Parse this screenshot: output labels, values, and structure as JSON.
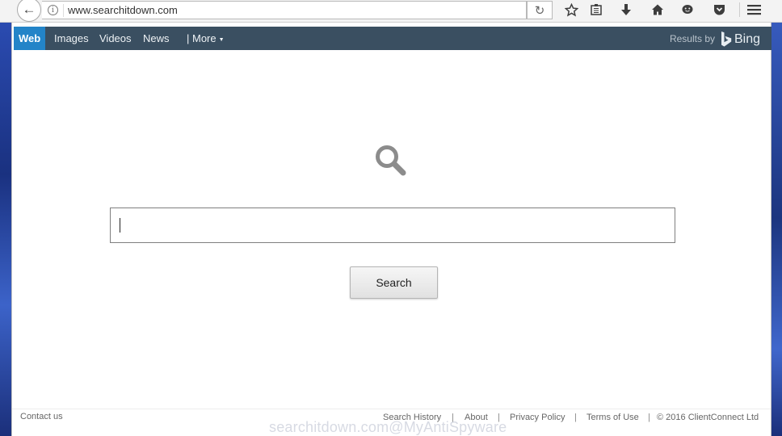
{
  "browser": {
    "url": "www.searchitdown.com"
  },
  "toolbar_icons": [
    "star-icon",
    "reading-list-icon",
    "download-icon",
    "home-icon",
    "chat-icon",
    "pocket-icon",
    "menu-icon"
  ],
  "nav": {
    "items": [
      {
        "label": "Web",
        "active": true
      },
      {
        "label": "Images",
        "active": false
      },
      {
        "label": "Videos",
        "active": false
      },
      {
        "label": "News",
        "active": false
      }
    ],
    "more_label": "| More",
    "results_by": "Results by",
    "provider": "Bing"
  },
  "search": {
    "value": "",
    "button_label": "Search"
  },
  "footer": {
    "contact": "Contact us",
    "links": [
      "Search History",
      "About",
      "Privacy Policy",
      "Terms of Use"
    ],
    "separator": "|",
    "copyright": "© 2016 ClientConnect Ltd"
  },
  "watermark": "searchitdown.com@MyAntiSpyware",
  "colors": {
    "navbar": "#3a4f61",
    "active_tab": "#2384c8",
    "page_bg": "#ffffff"
  }
}
